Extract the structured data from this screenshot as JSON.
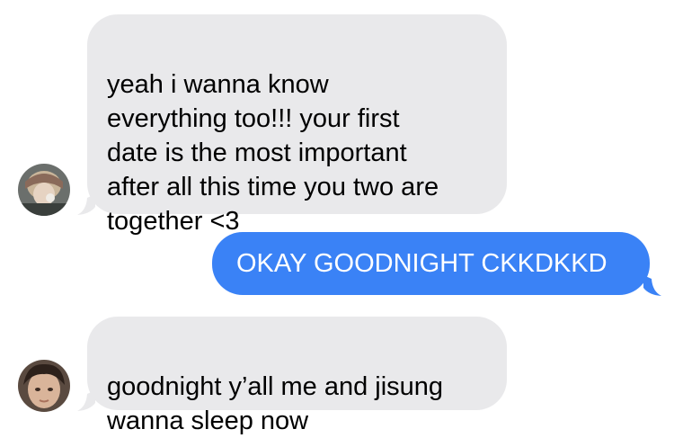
{
  "conversation": {
    "colors": {
      "incoming_bubble": "#e9e9eb",
      "outgoing_bubble": "#3a82f6",
      "incoming_text": "#000000",
      "outgoing_text": "#ffffff",
      "background": "#ffffff"
    },
    "messages": [
      {
        "direction": "incoming",
        "avatar": "contact-avatar-photo-1",
        "text": "yeah i wanna know\neverything too!!! your first\ndate is the most important\nafter all this time you two are\ntogether <3"
      },
      {
        "direction": "outgoing",
        "text": "OKAY GOODNIGHT CKKDKKD"
      },
      {
        "direction": "incoming",
        "avatar": "contact-avatar-photo-2",
        "text": "goodnight y’all me and jisung\nwanna sleep now"
      }
    ]
  }
}
